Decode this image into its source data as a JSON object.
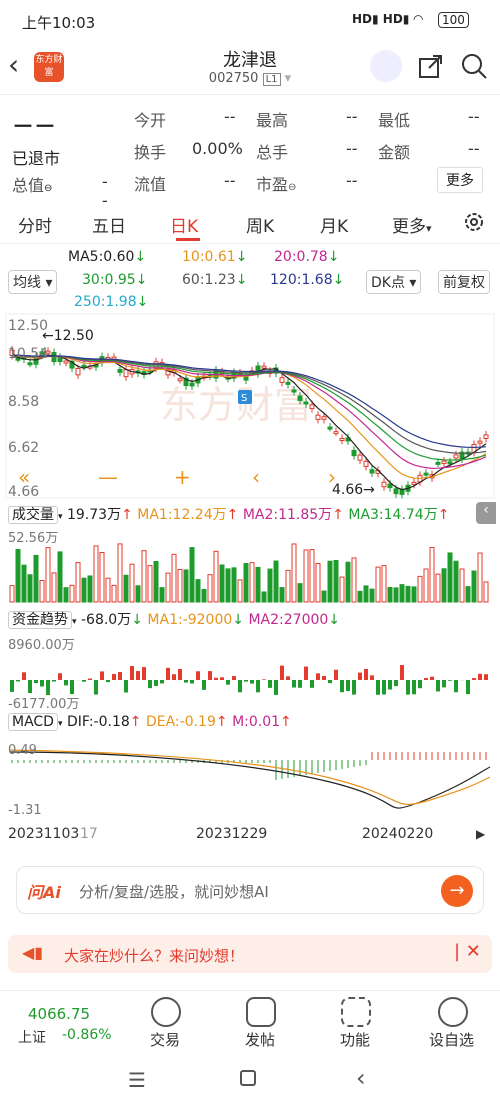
{
  "status": {
    "time": "上午10:03",
    "battery": "100"
  },
  "nav": {
    "title": "龙津退",
    "code": "002750",
    "market": "L1",
    "logo": "东方财富"
  },
  "quote": {
    "price": "－－",
    "state": "已退市",
    "rows": [
      [
        {
          "l": "今开",
          "v": "--"
        },
        {
          "l": "最高",
          "v": "--"
        },
        {
          "l": "最低",
          "v": "--"
        }
      ],
      [
        {
          "l": "换手",
          "v": "0.00%"
        },
        {
          "l": "总手",
          "v": "--"
        },
        {
          "l": "金额",
          "v": "--"
        }
      ],
      [
        {
          "l": "流值",
          "v": "--"
        },
        {
          "l": "市盈",
          "v": "--"
        }
      ]
    ],
    "total_label": "总值",
    "total_value": "--",
    "more": "更多"
  },
  "tabs": [
    "分时",
    "五日",
    "日K",
    "周K",
    "月K",
    "更多"
  ],
  "active_tab": "日K",
  "ma": {
    "ma5": "MA5:0.60",
    "ma10": "10:0.61",
    "ma20": "20:0.78",
    "ma30": "30:0.95",
    "ma60": "60:1.23",
    "ma120": "120:1.68",
    "ma250": "250:1.98",
    "junxian": "均线",
    "dk": "DK点",
    "fq": "前复权"
  },
  "chart_data": {
    "type": "candlestick",
    "price_axis": [
      "12.50",
      "10.54",
      "8.58",
      "6.62",
      "4.66"
    ],
    "marks": {
      "high": "12.50",
      "low": "4.66"
    },
    "volume": {
      "label": "成交量",
      "value": "19.73万",
      "ma1": "MA1:12.24万",
      "ma2": "MA2:11.85万",
      "ma3": "MA3:14.74万",
      "axis_top": "52.56万"
    },
    "fund": {
      "label": "资金趋势",
      "value": "-68.0万",
      "ma1": "MA1:-92000",
      "ma2": "MA2:27000",
      "axis_top": "8960.00万",
      "axis_bottom": "-6177.00万"
    },
    "macd": {
      "label": "MACD",
      "dif": "DIF:-0.18",
      "dea": "DEA:-0.19",
      "m": "M:0.01",
      "axis_top": "0.49",
      "axis_bottom": "-1.31"
    },
    "dates": [
      "20231103",
      "20231229",
      "20240220"
    ],
    "date_partial": "17"
  },
  "ai": {
    "logo": "问Ai",
    "placeholder": "分析/复盘/选股，就问妙想AI"
  },
  "hot": {
    "text": "大家在炒什么？来问妙想！"
  },
  "bottom": {
    "index_value": "4066.75",
    "index_name": "上证",
    "index_change": "-0.86%",
    "items": [
      "交易",
      "发帖",
      "功能",
      "设自选"
    ]
  },
  "colors": {
    "up": "#e33b2d",
    "down": "#1e9b2d",
    "accent": "#e33b2d"
  }
}
